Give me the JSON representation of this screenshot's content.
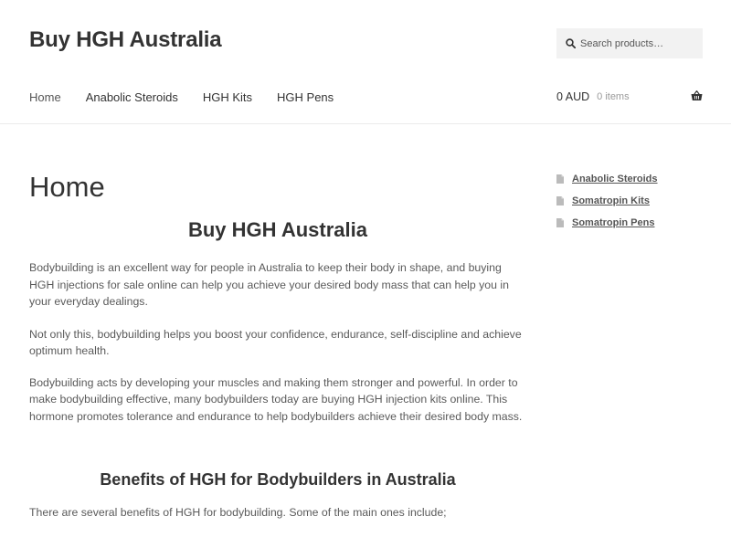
{
  "header": {
    "site_title": "Buy HGH Australia",
    "search": {
      "placeholder": "Search products…"
    },
    "nav": [
      {
        "label": "Home",
        "active": true
      },
      {
        "label": "Anabolic Steroids"
      },
      {
        "label": "HGH Kits"
      },
      {
        "label": "HGH Pens"
      }
    ],
    "cart": {
      "total": "0 AUD",
      "items": "0 items"
    }
  },
  "main": {
    "page_title": "Home",
    "heading": "Buy HGH Australia",
    "paragraphs": [
      "Bodybuilding is an excellent way for people in Australia to keep their body in shape, and buying HGH injections for sale online can help you achieve your desired body mass that can help you in your everyday dealings.",
      "Not only this, bodybuilding helps you boost your confidence, endurance, self-discipline and achieve optimum health.",
      "Bodybuilding acts by developing your muscles and making them stronger and powerful. In order to make bodybuilding effective, many bodybuilders today are buying HGH injection kits online. This hormone promotes tolerance and endurance to help bodybuilders achieve their desired body mass."
    ],
    "subheading": "Benefits of HGH for Bodybuilders in Australia",
    "paragraph_after": "There are several benefits of HGH for bodybuilding. Some of the main ones include;"
  },
  "sidebar": {
    "items": [
      {
        "label": "Anabolic Steroids"
      },
      {
        "label": "Somatropin Kits"
      },
      {
        "label": "Somatropin Pens"
      }
    ]
  },
  "icons": {
    "search": "search-icon",
    "cart": "basket-icon",
    "page": "page-icon"
  }
}
